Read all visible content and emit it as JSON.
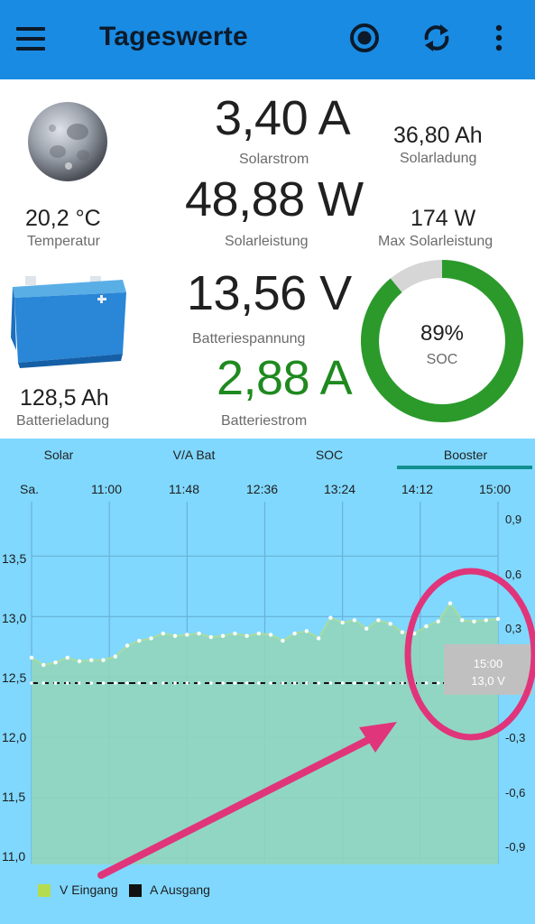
{
  "appbar": {
    "title": "Tageswerte",
    "icons": [
      "menu-icon",
      "record-icon",
      "refresh-icon",
      "more-vert-icon"
    ],
    "color": "#1a8be2"
  },
  "values": {
    "temperature": {
      "value": "20,2 °C",
      "label": "Temperatur"
    },
    "solar_current": {
      "value": "3,40 A",
      "label": "Solarstrom"
    },
    "solar_charge": {
      "value": "36,80 Ah",
      "label": "Solarladung"
    },
    "solar_power": {
      "value": "48,88 W",
      "label": "Solarleistung"
    },
    "max_solar_power": {
      "value": "174 W",
      "label": "Max Solarleistung"
    },
    "battery_voltage": {
      "value": "13,56 V",
      "label": "Batteriespannung"
    },
    "battery_current": {
      "value": "2,88 A",
      "label": "Batteriestrom"
    },
    "battery_charge": {
      "value": "128,5 Ah",
      "label": "Batterieladung"
    },
    "soc": {
      "value": "89%",
      "label": "SOC",
      "fraction": 0.89
    }
  },
  "tabs": [
    {
      "label": "Solar",
      "active": false
    },
    {
      "label": "V/A Bat",
      "active": false
    },
    {
      "label": "SOC",
      "active": false
    },
    {
      "label": "Booster",
      "active": true
    }
  ],
  "chart_data": {
    "type": "area",
    "x_ticks": [
      "Sa.",
      "11:00",
      "11:48",
      "12:36",
      "13:24",
      "14:12",
      "15:00"
    ],
    "y_left_ticks": [
      "13,5",
      "13,0",
      "12,5",
      "12,0",
      "11,5",
      "11,0"
    ],
    "y_right_ticks": [
      "0,9",
      "0,6",
      "0,3",
      "-0,3",
      "-0,6",
      "-0,9"
    ],
    "ylim_left": [
      10.95,
      13.95
    ],
    "ylim_right": [
      -1.0,
      1.0
    ],
    "grid": true,
    "legend_position": "bottom-left",
    "series": [
      {
        "name": "V Eingang",
        "axis": "left",
        "color": "#b5dc4e",
        "values": [
          12.66,
          12.6,
          12.62,
          12.66,
          12.63,
          12.64,
          12.64,
          12.67,
          12.76,
          12.8,
          12.82,
          12.86,
          12.84,
          12.85,
          12.86,
          12.83,
          12.84,
          12.86,
          12.84,
          12.86,
          12.85,
          12.8,
          12.86,
          12.88,
          12.82,
          12.99,
          12.95,
          12.97,
          12.9,
          12.97,
          12.94,
          12.87,
          12.86,
          12.92,
          12.96,
          13.11,
          12.97,
          12.96,
          12.97,
          12.98
        ]
      },
      {
        "name": "A Ausgang",
        "axis": "right",
        "color": "#111111",
        "values": [
          0.0,
          0.0,
          0.0,
          0.0,
          0.0,
          0.0,
          0.0,
          0.0,
          0.0,
          0.0,
          0.0,
          0.0,
          0.0,
          0.0,
          0.0,
          0.0,
          0.0,
          0.0,
          0.0,
          0.0,
          0.0,
          0.0,
          0.0,
          0.0,
          0.0,
          0.0,
          0.0,
          0.0,
          0.0,
          0.0,
          0.0,
          0.0,
          0.0,
          0.0,
          0.0,
          0.0,
          0.0,
          0.0,
          0.0,
          0.0
        ]
      }
    ]
  },
  "tooltip": {
    "time": "15:00",
    "value": "13,0 V"
  },
  "colors": {
    "chart_background": "#80d8ff",
    "annotation": "#e0357a",
    "soc_ring": "#2b9a2b",
    "soc_ring_track": "#d6d6d6"
  }
}
